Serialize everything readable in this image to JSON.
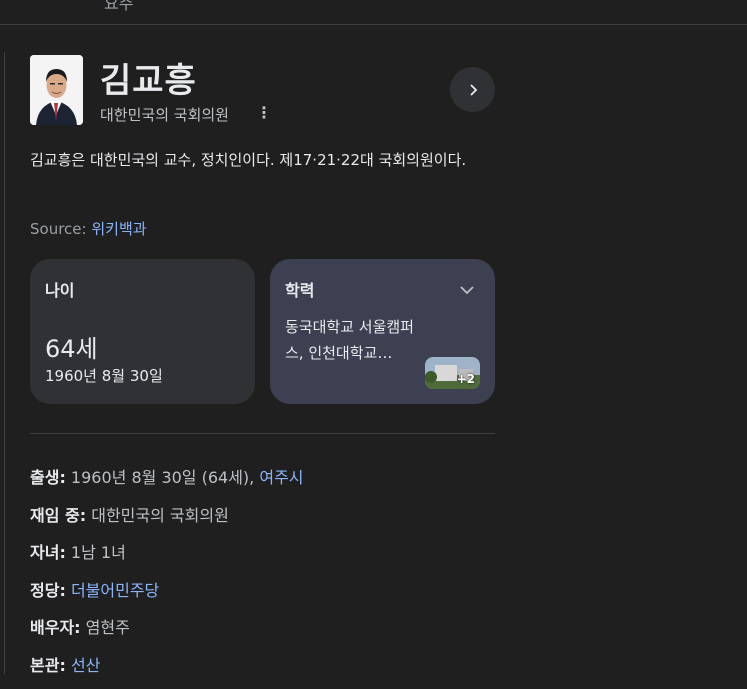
{
  "topbar": {
    "cut_text": "요주"
  },
  "header": {
    "name": "김교흥",
    "subtitle": "대한민국의 국회의원",
    "more_icon": "kebab-vertical-icon",
    "next_icon": "chevron-right-icon"
  },
  "description": "김교흥은 대한민국의 교수, 정치인이다. 제17·21·22대 국회의원이다.",
  "source": {
    "label": "Source:",
    "link": "위키백과"
  },
  "cards": {
    "age": {
      "title": "나이",
      "value": "64세",
      "date": "1960년 8월 30일"
    },
    "education": {
      "title": "학력",
      "text": "동국대학교 서울캠퍼스, 인천대학교…",
      "more_count": "+2"
    }
  },
  "facts": [
    {
      "label": "출생:",
      "segments": [
        {
          "text": " 1960년 8월 30일 (64세), ",
          "link": false
        },
        {
          "text": "여주시",
          "link": true
        }
      ]
    },
    {
      "label": "재임 중:",
      "segments": [
        {
          "text": " 대한민국의 국회의원",
          "link": false
        }
      ]
    },
    {
      "label": "자녀:",
      "segments": [
        {
          "text": " 1남 1녀",
          "link": false
        }
      ]
    },
    {
      "label": "정당:",
      "segments": [
        {
          "text": " ",
          "link": false
        },
        {
          "text": "더불어민주당",
          "link": true
        }
      ]
    },
    {
      "label": "배우자:",
      "segments": [
        {
          "text": " 염현주",
          "link": false
        }
      ]
    },
    {
      "label": "본관:",
      "segments": [
        {
          "text": " ",
          "link": false
        },
        {
          "text": "선산",
          "link": true
        }
      ]
    }
  ],
  "colors": {
    "background": "#1f1f1f",
    "link": "#8ab4f8",
    "card": "#303134",
    "card_alt": "#3c4050"
  }
}
